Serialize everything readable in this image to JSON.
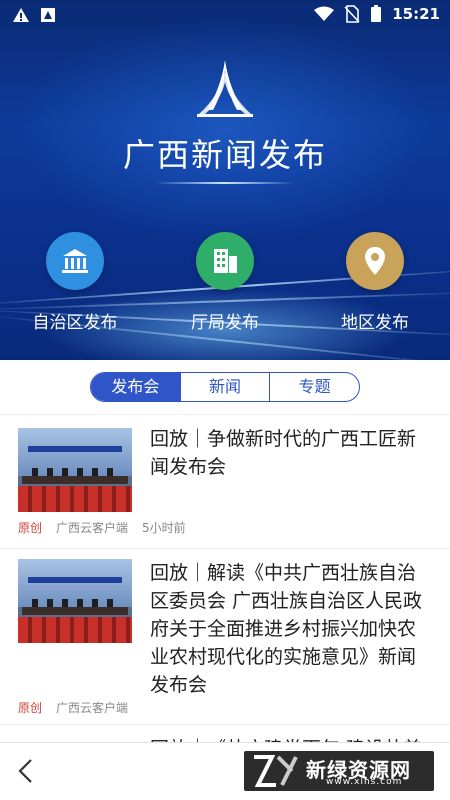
{
  "status_bar": {
    "time": "15:21",
    "icons": [
      "warning-icon",
      "notification-icon",
      "wifi-icon",
      "no-sim-icon",
      "battery-icon"
    ]
  },
  "header": {
    "title": "广西新闻发布",
    "logo": "building-logo"
  },
  "shortcuts": [
    {
      "label": "自治区发布",
      "icon": "government-building-icon",
      "color": "#2f8fe0"
    },
    {
      "label": "厅局发布",
      "icon": "office-building-icon",
      "color": "#2fae6a"
    },
    {
      "label": "地区发布",
      "icon": "location-pin-icon",
      "color": "#c9a35a"
    }
  ],
  "tabs": [
    {
      "label": "发布会",
      "active": true
    },
    {
      "label": "新闻",
      "active": false
    },
    {
      "label": "专题",
      "active": false
    }
  ],
  "news": [
    {
      "headline": "回放｜争做新时代的广西工匠新闻发布会",
      "tag": "原创",
      "source": "广西云客户端",
      "time": "5小时前"
    },
    {
      "headline": "回放｜解读《中共广西壮族自治区委员会 广西壮族自治区人民政府关于全面推进乡村振兴加快农业农村现代化的实施意见》新闻发布会",
      "tag": "原创",
      "source": "广西云客户端",
      "time": ""
    },
    {
      "headline": "回放｜《壮广建党百年 建设壮美",
      "tag": "",
      "source": "",
      "time": ""
    }
  ],
  "bottom_bar": {
    "back_icon": "chevron-left-icon",
    "watermark_name": "新绿资源网",
    "watermark_url": "www.xlhs.com"
  },
  "colors": {
    "accent": "#2f55c8",
    "tag": "#d0453a",
    "hero": "#0d3a9a"
  }
}
